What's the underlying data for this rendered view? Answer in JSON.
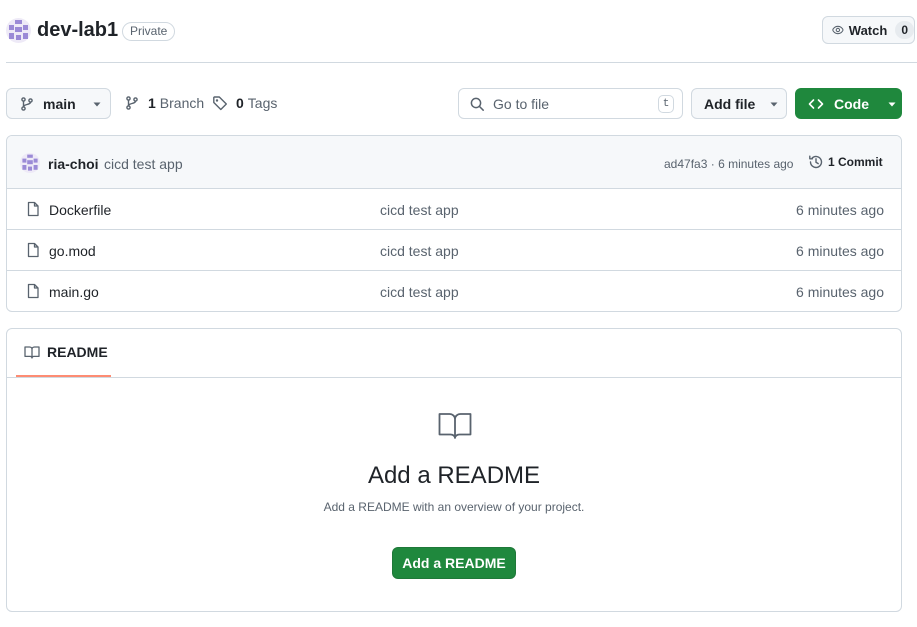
{
  "repo": {
    "name": "dev-lab1",
    "visibility": "Private"
  },
  "watch": {
    "label": "Watch",
    "count": "0"
  },
  "toolbar": {
    "branch_name": "main",
    "branches_count": "1",
    "branches_label": "Branch",
    "tags_count": "0",
    "tags_label": "Tags",
    "search_placeholder": "Go to file",
    "search_shortcut": "t",
    "add_file_label": "Add file",
    "code_label": "Code"
  },
  "latest_commit": {
    "author": "ria-choi",
    "message": "cicd test app",
    "sha": "ad47fa3",
    "separator": "·",
    "time": "6 minutes ago",
    "commit_count_label": "1 Commit"
  },
  "files": [
    {
      "name": "Dockerfile",
      "commit": "cicd test app",
      "time": "6 minutes ago"
    },
    {
      "name": "go.mod",
      "commit": "cicd test app",
      "time": "6 minutes ago"
    },
    {
      "name": "main.go",
      "commit": "cicd test app",
      "time": "6 minutes ago"
    }
  ],
  "readme": {
    "tab_label": "README",
    "empty_title": "Add a README",
    "empty_description": "Add a README with an overview of your project.",
    "button_label": "Add a README"
  },
  "colors": {
    "primary_button": "#1f883d",
    "tab_underline": "#fd8c73",
    "border": "#d1d9e0",
    "muted_text": "#59636e"
  },
  "icons": [
    "repo-avatar-icon",
    "eye-icon",
    "git-branch-icon",
    "tag-icon",
    "search-icon",
    "code-icon",
    "history-icon",
    "file-icon",
    "book-icon"
  ]
}
